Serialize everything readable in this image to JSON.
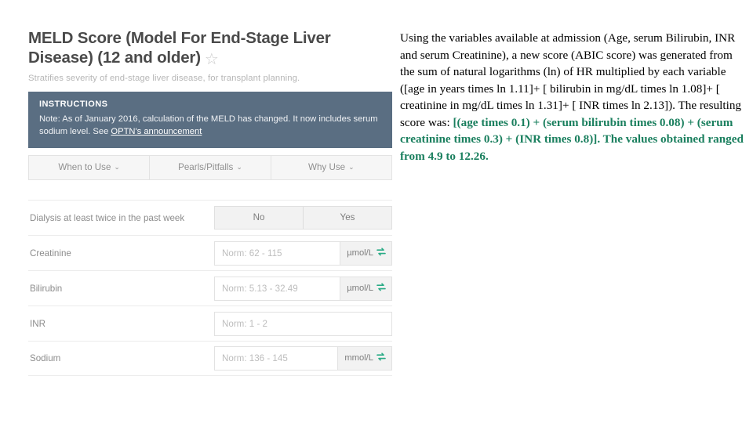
{
  "calculator": {
    "title": "MELD Score (Model For End-Stage Liver Disease) (12 and older)",
    "favorite_icon": "star-outline-icon",
    "subtitle": "Stratifies severity of end-stage liver disease, for transplant planning.",
    "instructions": {
      "heading": "INSTRUCTIONS",
      "body_before_link": "Note: As of January 2016, calculation of the MELD has changed. It now includes serum sodium level. See ",
      "link_text": "OPTN's announcement",
      "body_after_link": ""
    },
    "tabs": [
      {
        "label": "When to Use",
        "chevron": "⌄"
      },
      {
        "label": "Pearls/Pitfalls",
        "chevron": "⌄"
      },
      {
        "label": "Why Use",
        "chevron": "⌄"
      }
    ],
    "rows": [
      {
        "label": "Dialysis at least twice in the past week",
        "type": "segmented",
        "options": [
          "No",
          "Yes"
        ]
      },
      {
        "label": "Creatinine",
        "type": "input",
        "placeholder": "Norm: 62 - 115",
        "unit": "µmol/L",
        "unit_icon": "swap-arrows-icon"
      },
      {
        "label": "Bilirubin",
        "type": "input",
        "placeholder": "Norm: 5.13 - 32.49",
        "unit": "µmol/L",
        "unit_icon": "swap-arrows-icon"
      },
      {
        "label": "INR",
        "type": "input",
        "placeholder": "Norm: 1 - 2",
        "unit": null,
        "unit_icon": null
      },
      {
        "label": "Sodium",
        "type": "input",
        "placeholder": "Norm: 136 - 145",
        "unit": "mmol/L",
        "unit_icon": "swap-arrows-icon"
      }
    ]
  },
  "annotation": {
    "plain_text_1": "Using the variables available at admission (Age, serum Bilirubin, INR and serum Creatinine), a new score (ABIC score) was generated from the sum of natural logarithms (ln) of HR multiplied by each variable ([age in years times ln 1.11]+ [ bilirubin in mg/dL times ln 1.08]+ [ creatinine in mg/dL times ln 1.31]+ [ INR times ln 2.13]). The resulting score was: ",
    "highlight_text": "[(age times 0.1) + (serum bilirubin times 0.08) + (serum creatinine times 0.3) + (INR times 0.8)]. The values obtained ranged from 4.9 to 12.26.",
    "highlight_color": "#1a7f5e"
  },
  "colors": {
    "instructions_panel": "#5a6e82",
    "title_text": "#4a4a4a",
    "accent_teal": "#2aab86",
    "page_background": "#ffffff"
  }
}
